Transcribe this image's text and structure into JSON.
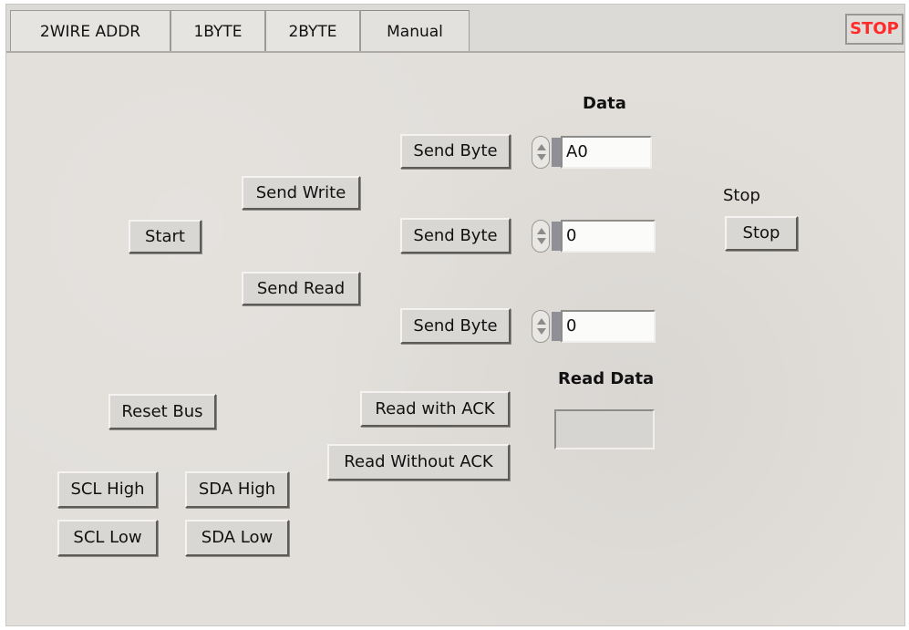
{
  "tabs": [
    {
      "label": "2WIRE ADDR"
    },
    {
      "label": "1BYTE"
    },
    {
      "label": "2BYTE"
    },
    {
      "label": "Manual"
    }
  ],
  "stop_button_top": "STOP",
  "labels": {
    "data": "Data",
    "stop": "Stop",
    "read_data": "Read Data"
  },
  "buttons": {
    "send_byte_1": "Send Byte",
    "send_write": "Send Write",
    "start": "Start",
    "send_byte_2": "Send Byte",
    "send_read": "Send Read",
    "send_byte_3": "Send Byte",
    "stop": "Stop",
    "reset_bus": "Reset Bus",
    "read_with_ack": "Read with ACK",
    "read_without_ack": "Read Without ACK",
    "scl_high": "SCL High",
    "sda_high": "SDA High",
    "scl_low": "SCL Low",
    "sda_low": "SDA Low"
  },
  "data_fields": [
    {
      "value": "A0"
    },
    {
      "value": "0"
    },
    {
      "value": "0"
    }
  ],
  "read_data_value": ""
}
